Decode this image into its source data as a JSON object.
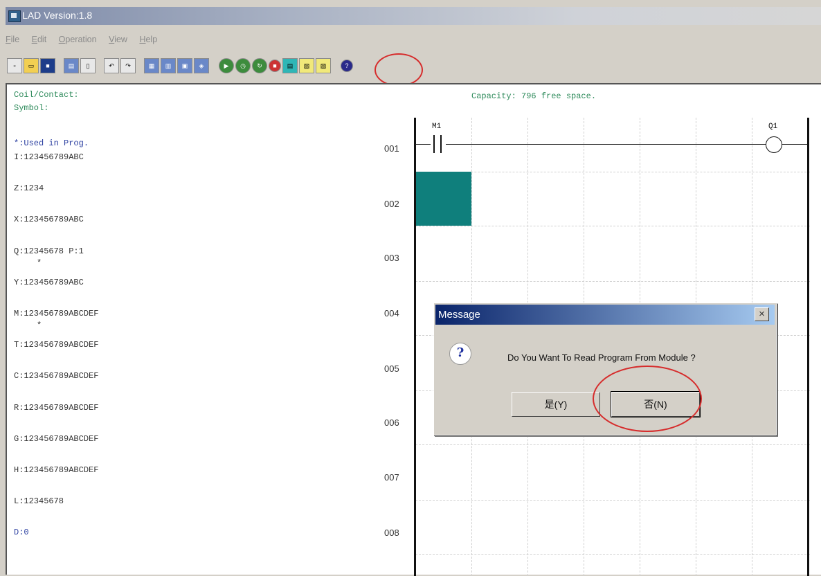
{
  "window": {
    "title": "LAD Version:1.8"
  },
  "menu": [
    {
      "label": "File",
      "ul": "F"
    },
    {
      "label": "Edit",
      "ul": "E"
    },
    {
      "label": "Operation",
      "ul": "O"
    },
    {
      "label": "View",
      "ul": "V"
    },
    {
      "label": "Help",
      "ul": "H"
    }
  ],
  "toolbar": {
    "icons": [
      "new-icon",
      "open-icon",
      "save-icon",
      "print-icon",
      "print-preview-icon",
      "undo-icon",
      "redo-icon",
      "tool-1-icon",
      "tool-2-icon",
      "tool-3-icon",
      "tool-4-icon",
      "run-icon",
      "monitor-icon",
      "stop-run-icon",
      "stop-icon",
      "read-program-icon",
      "read-module-icon",
      "write-module-icon",
      "help-icon"
    ],
    "highlight_color": "#d62c2c"
  },
  "status": {
    "coil_contact": "Coil/Contact:",
    "symbol": "Symbol:",
    "capacity": "Capacity: 796 free space."
  },
  "symbols": {
    "legend": "*:Used in Prog.",
    "items": [
      "I:123456789ABC",
      "Z:1234",
      "X:123456789ABC",
      "Q:12345678 P:1",
      "Y:123456789ABC",
      "M:123456789ABCDEF",
      "T:123456789ABCDEF",
      "C:123456789ABCDEF",
      "R:123456789ABCDEF",
      "G:123456789ABCDEF",
      "H:123456789ABCDEF",
      "L:12345678",
      "D:0"
    ],
    "marks": [
      "*",
      "*"
    ]
  },
  "ladder": {
    "rows": [
      "001",
      "002",
      "003",
      "004",
      "005",
      "006",
      "007",
      "008"
    ],
    "contact_label": "M1",
    "coil_label": "Q1",
    "cursor_color": "#0f7f7c"
  },
  "dialog": {
    "title": "Message",
    "message": "Do You Want To Read Program From Module ?",
    "yes": "是(Y)",
    "no": "否(N)",
    "close": "×"
  }
}
